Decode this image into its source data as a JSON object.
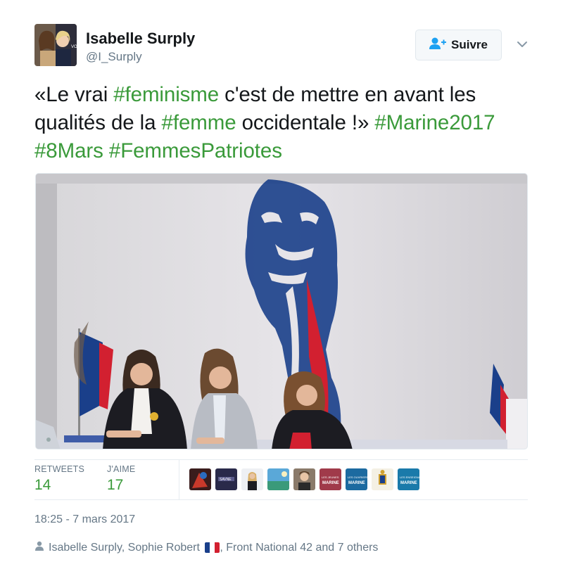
{
  "author": {
    "name": "Isabelle Surply",
    "handle": "@I_Surply"
  },
  "follow_button": {
    "label": "Suivre",
    "icon": "follow-user-plus-icon"
  },
  "more_menu_icon": "chevron-down-icon",
  "tweet": {
    "segments": [
      {
        "text": "«Le vrai ",
        "hashtag": false
      },
      {
        "text": "#feminisme",
        "hashtag": true
      },
      {
        "text": " c'est de mettre en avant les qualités de la ",
        "hashtag": false
      },
      {
        "text": "#femme",
        "hashtag": true
      },
      {
        "text": " occidentale !» ",
        "hashtag": false
      },
      {
        "text": "#Marine2017",
        "hashtag": true
      },
      {
        "text": " ",
        "hashtag": false
      },
      {
        "text": "#8Mars",
        "hashtag": true
      },
      {
        "text": " ",
        "hashtag": false
      },
      {
        "text": "#FemmesPatriotes",
        "hashtag": true
      }
    ]
  },
  "stats": {
    "retweets_label": "RETWEETS",
    "retweets_value": "14",
    "likes_label": "J'AIME",
    "likes_value": "17"
  },
  "likers": [
    {
      "avatar": "liker-avatar-1"
    },
    {
      "avatar": "liker-avatar-2"
    },
    {
      "avatar": "liker-avatar-3"
    },
    {
      "avatar": "liker-avatar-4"
    },
    {
      "avatar": "liker-avatar-5"
    },
    {
      "avatar": "liker-avatar-6"
    },
    {
      "avatar": "liker-avatar-7"
    },
    {
      "avatar": "liker-avatar-8"
    },
    {
      "avatar": "liker-avatar-9"
    }
  ],
  "timestamp": "18:25 - 7 mars 2017",
  "context": {
    "icon": "person-icon",
    "before_flag": "Isabelle Surply, Sophie Robert",
    "after_flag": ", Front National 42 and 7 others"
  },
  "colors": {
    "hashtag": "#3a9a3a",
    "text": "#14171a",
    "muted": "#657786",
    "border": "#e6ecf0",
    "follow_icon": "#1da1f2"
  }
}
